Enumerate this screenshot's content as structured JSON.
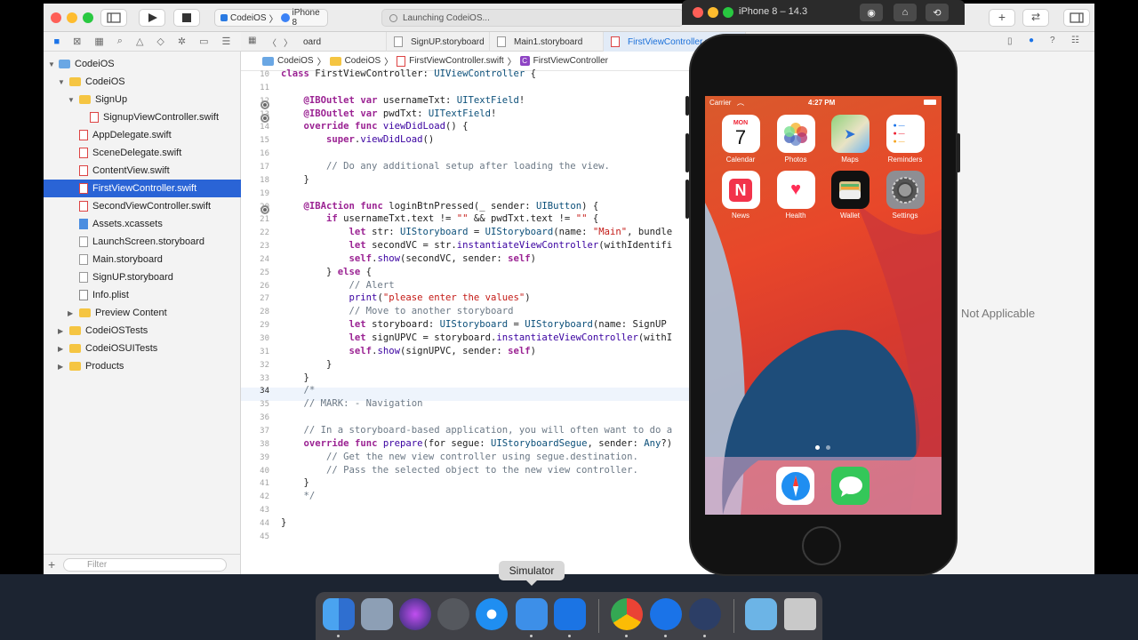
{
  "toolbar": {
    "scheme_project": "CodeiOS",
    "scheme_device": "iPhone 8",
    "status_text": "Launching CodeiOS..."
  },
  "navigator": {
    "filter_placeholder": "Filter",
    "items": [
      {
        "label": "CodeiOS"
      },
      {
        "label": "CodeiOS"
      },
      {
        "label": "SignUp"
      },
      {
        "label": "SignupViewController.swift"
      },
      {
        "label": "AppDelegate.swift"
      },
      {
        "label": "SceneDelegate.swift"
      },
      {
        "label": "ContentView.swift"
      },
      {
        "label": "FirstViewController.swift"
      },
      {
        "label": "SecondViewController.swift"
      },
      {
        "label": "Assets.xcassets"
      },
      {
        "label": "LaunchScreen.storyboard"
      },
      {
        "label": "Main.storyboard"
      },
      {
        "label": "SignUP.storyboard"
      },
      {
        "label": "Info.plist"
      },
      {
        "label": "Preview Content"
      },
      {
        "label": "CodeiOSTests"
      },
      {
        "label": "CodeiOSUITests"
      },
      {
        "label": "Products"
      }
    ]
  },
  "tabs": [
    {
      "label": "oard"
    },
    {
      "label": "SignUP.storyboard"
    },
    {
      "label": "Main1.storyboard"
    },
    {
      "label": "FirstViewController.swift"
    }
  ],
  "jumpbar": [
    "CodeiOS",
    "CodeiOS",
    "FirstViewController.swift",
    "FirstViewController"
  ],
  "code": {
    "line_numbers": [
      "10",
      "11",
      "12",
      "13",
      "14",
      "15",
      "16",
      "17",
      "18",
      "19",
      "20",
      "21",
      "22",
      "23",
      "24",
      "25",
      "26",
      "27",
      "28",
      "29",
      "30",
      "31",
      "32",
      "33",
      "34",
      "35",
      "36",
      "37",
      "38",
      "39",
      "40",
      "41",
      "42",
      "43",
      "44",
      "45"
    ],
    "current_line": "34",
    "lines": [
      "class FirstViewController: UIViewController {",
      "",
      "    @IBOutlet var usernameTxt: UITextField!",
      "    @IBOutlet var pwdTxt: UITextField!",
      "    override func viewDidLoad() {",
      "        super.viewDidLoad()",
      "",
      "        // Do any additional setup after loading the view.",
      "    }",
      "",
      "    @IBAction func loginBtnPressed(_ sender: UIButton) {",
      "        if usernameTxt.text != \"\" && pwdTxt.text != \"\" {",
      "            let str: UIStoryboard = UIStoryboard(name: \"Main\", bundle",
      "            let secondVC = str.instantiateViewController(withIdentifi",
      "            self.show(secondVC, sender: self)",
      "        } else {",
      "            // Alert",
      "            print(\"please enter the values\")",
      "            // Move to another storyboard",
      "            let storyboard: UIStoryboard = UIStoryboard(name: \"SignUP",
      "            let signUPVC = storyboard.instantiateViewController(withI",
      "            self.show(signUPVC, sender: self)",
      "        }",
      "    }",
      "    /*",
      "    // MARK: - Navigation",
      "",
      "    // In a storyboard-based application, you will often want to do a",
      "    override func prepare(for segue: UIStoryboardSegue, sender: Any?)",
      "        // Get the new view controller using segue.destination.",
      "        // Pass the selected object to the new view controller.",
      "    }",
      "    */",
      "",
      "}",
      ""
    ]
  },
  "inspector": {
    "message": "Not Applicable"
  },
  "simulator": {
    "title": "iPhone 8 – 14.3",
    "carrier": "Carrier",
    "time": "4:27 PM",
    "calendar_day": "MON",
    "calendar_date": "7",
    "apps": [
      {
        "label": "Calendar"
      },
      {
        "label": "Photos"
      },
      {
        "label": "Maps"
      },
      {
        "label": "Reminders"
      },
      {
        "label": "News"
      },
      {
        "label": "Health"
      },
      {
        "label": "Wallet"
      },
      {
        "label": "Settings"
      }
    ]
  },
  "dock": {
    "tooltip": "Simulator"
  }
}
